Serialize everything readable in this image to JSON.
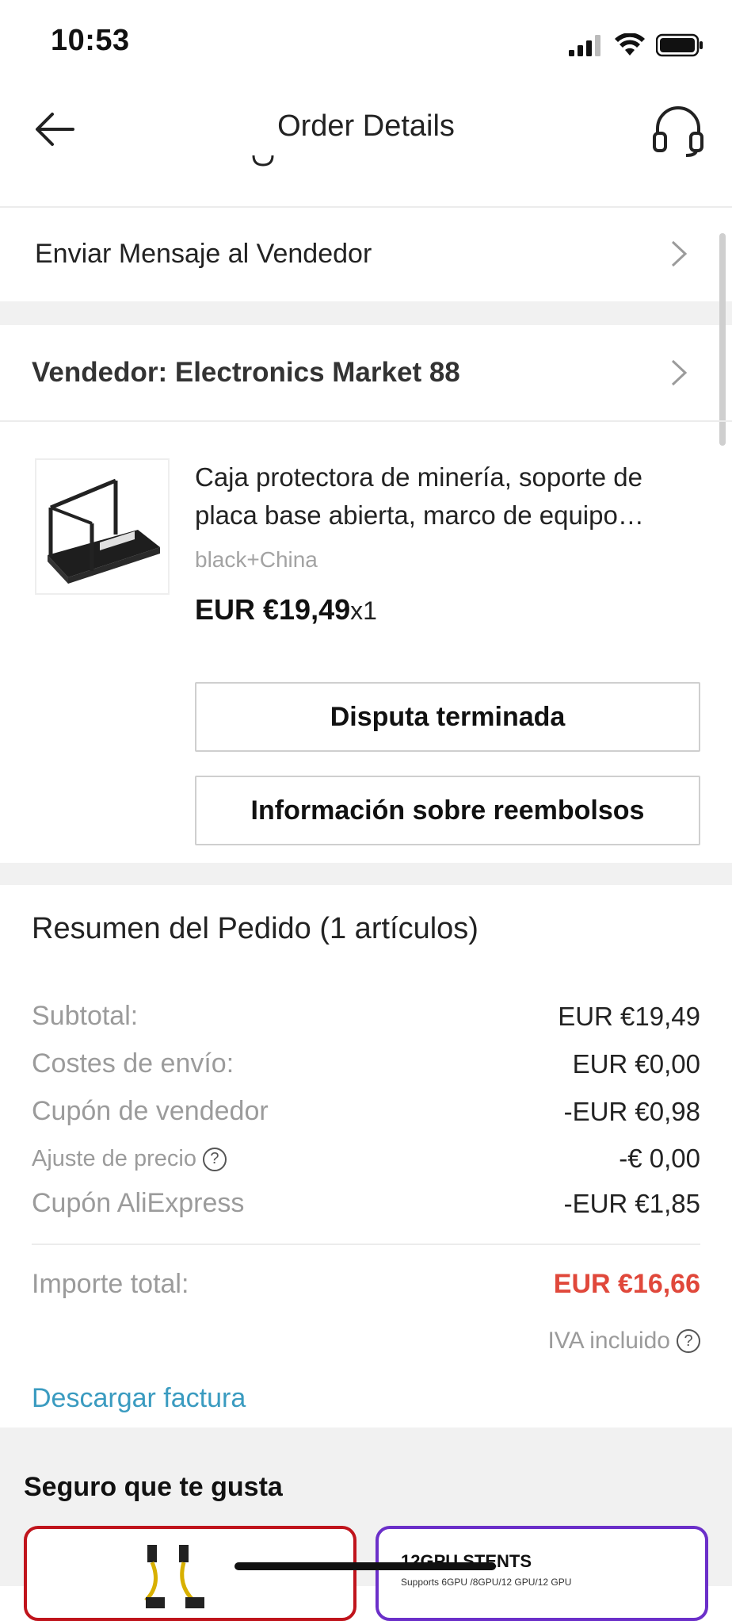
{
  "status_bar": {
    "time": "10:53"
  },
  "header": {
    "title": "Order Details"
  },
  "rows": {
    "message_seller": "Enviar Mensaje al Vendedor",
    "seller": "Vendedor: Electronics Market 88"
  },
  "product": {
    "title": "Caja protectora de minería, soporte de placa base abierta, marco de equipo…",
    "variant": "black+China",
    "price": "EUR €19,49",
    "qty": "x1",
    "buttons": {
      "dispute": "Disputa terminada",
      "refund_info": "Información sobre reembolsos"
    }
  },
  "summary": {
    "title": "Resumen del Pedido (1 artículos)",
    "rows": [
      {
        "label": "Subtotal:",
        "value": "EUR €19,49"
      },
      {
        "label": "Costes de envío:",
        "value": "EUR €0,00"
      },
      {
        "label": "Cupón de vendedor",
        "value": "-EUR €0,98"
      },
      {
        "label": "Ajuste de precio",
        "value": "-€ 0,00"
      },
      {
        "label": "Cupón AliExpress",
        "value": "-EUR €1,85"
      }
    ],
    "total_label": "Importe total:",
    "total_value": "EUR €16,66",
    "vat_label": "IVA incluido",
    "download_invoice": "Descargar factura"
  },
  "recommendations": {
    "title": "Seguro que te gusta",
    "card2_title": "12GPU STENTS",
    "card2_subtitle": "Supports 6GPU /8GPU/12 GPU/12 GPU"
  },
  "colors": {
    "total_red": "#e0483b",
    "link_blue": "#3a9bc0",
    "card_red": "#c0141c",
    "card_purple": "#6b2fc9"
  }
}
